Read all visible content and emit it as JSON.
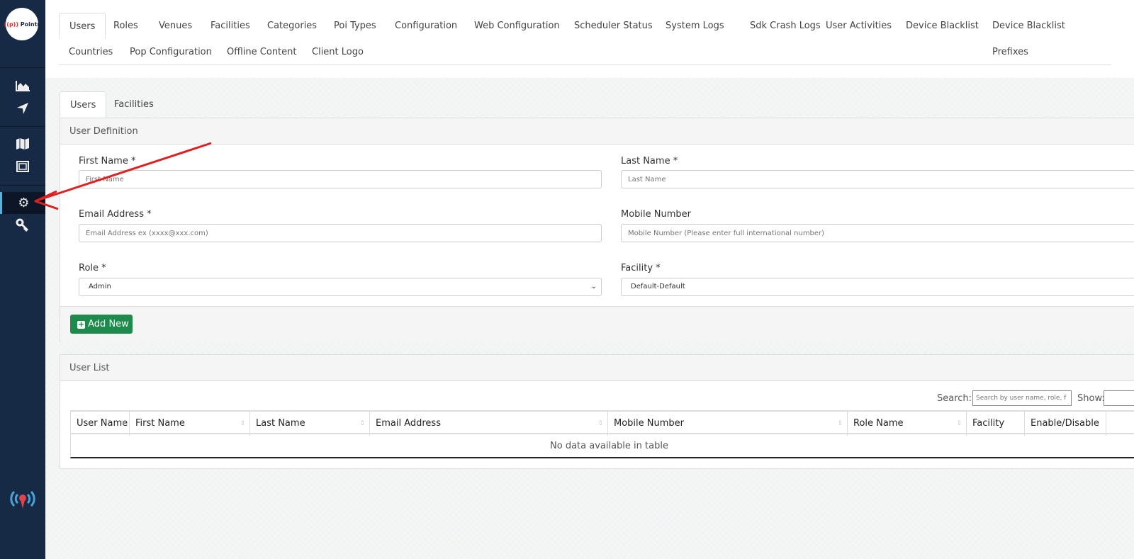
{
  "brand": {
    "logo_text": "Pointr"
  },
  "sidebar": {
    "icons": [
      "chart-area-icon",
      "location-arrow-icon",
      "map-icon",
      "floorplan-icon",
      "gear-icon",
      "key-icon"
    ],
    "bottom_icon": "pointr-beacon-icon"
  },
  "top_tabs": [
    "Users",
    "Roles",
    "Venues",
    "Facilities",
    "Categories",
    "Poi Types",
    "Configuration",
    "Web Configuration",
    "Scheduler Status",
    "System Logs",
    "Sdk Crash Logs",
    "User Activities",
    "Device Blacklist",
    "Device Blacklist Prefixes",
    "Countries",
    "Pop Configuration",
    "Offline Content",
    "Client Logo"
  ],
  "sub_tabs": [
    "Users",
    "Facilities"
  ],
  "user_definition": {
    "title": "User Definition",
    "first_name": {
      "label": "First Name *",
      "placeholder": "First Name"
    },
    "last_name": {
      "label": "Last Name *",
      "placeholder": "Last Name"
    },
    "email": {
      "label": "Email Address *",
      "placeholder": "Email Address ex (xxxx@xxx.com)"
    },
    "mobile": {
      "label": "Mobile Number",
      "placeholder": "Mobile Number (Please enter full international number)"
    },
    "role": {
      "label": "Role *",
      "value": "Admin"
    },
    "facility": {
      "label": "Facility *",
      "value": "Default-Default"
    },
    "add_button": "Add New"
  },
  "user_list": {
    "title": "User List",
    "search_label": "Search:",
    "search_placeholder": "Search by user name, role, f",
    "show_label": "Show:",
    "columns": [
      "User Name",
      "First Name",
      "Last Name",
      "Email Address",
      "Mobile Number",
      "Role Name",
      "Facility",
      "Enable/Disable"
    ],
    "empty": "No data available in table"
  },
  "colors": {
    "sidebar": "#172a45",
    "button": "#1e8a4c",
    "annotation_arrow": "#e02020"
  }
}
